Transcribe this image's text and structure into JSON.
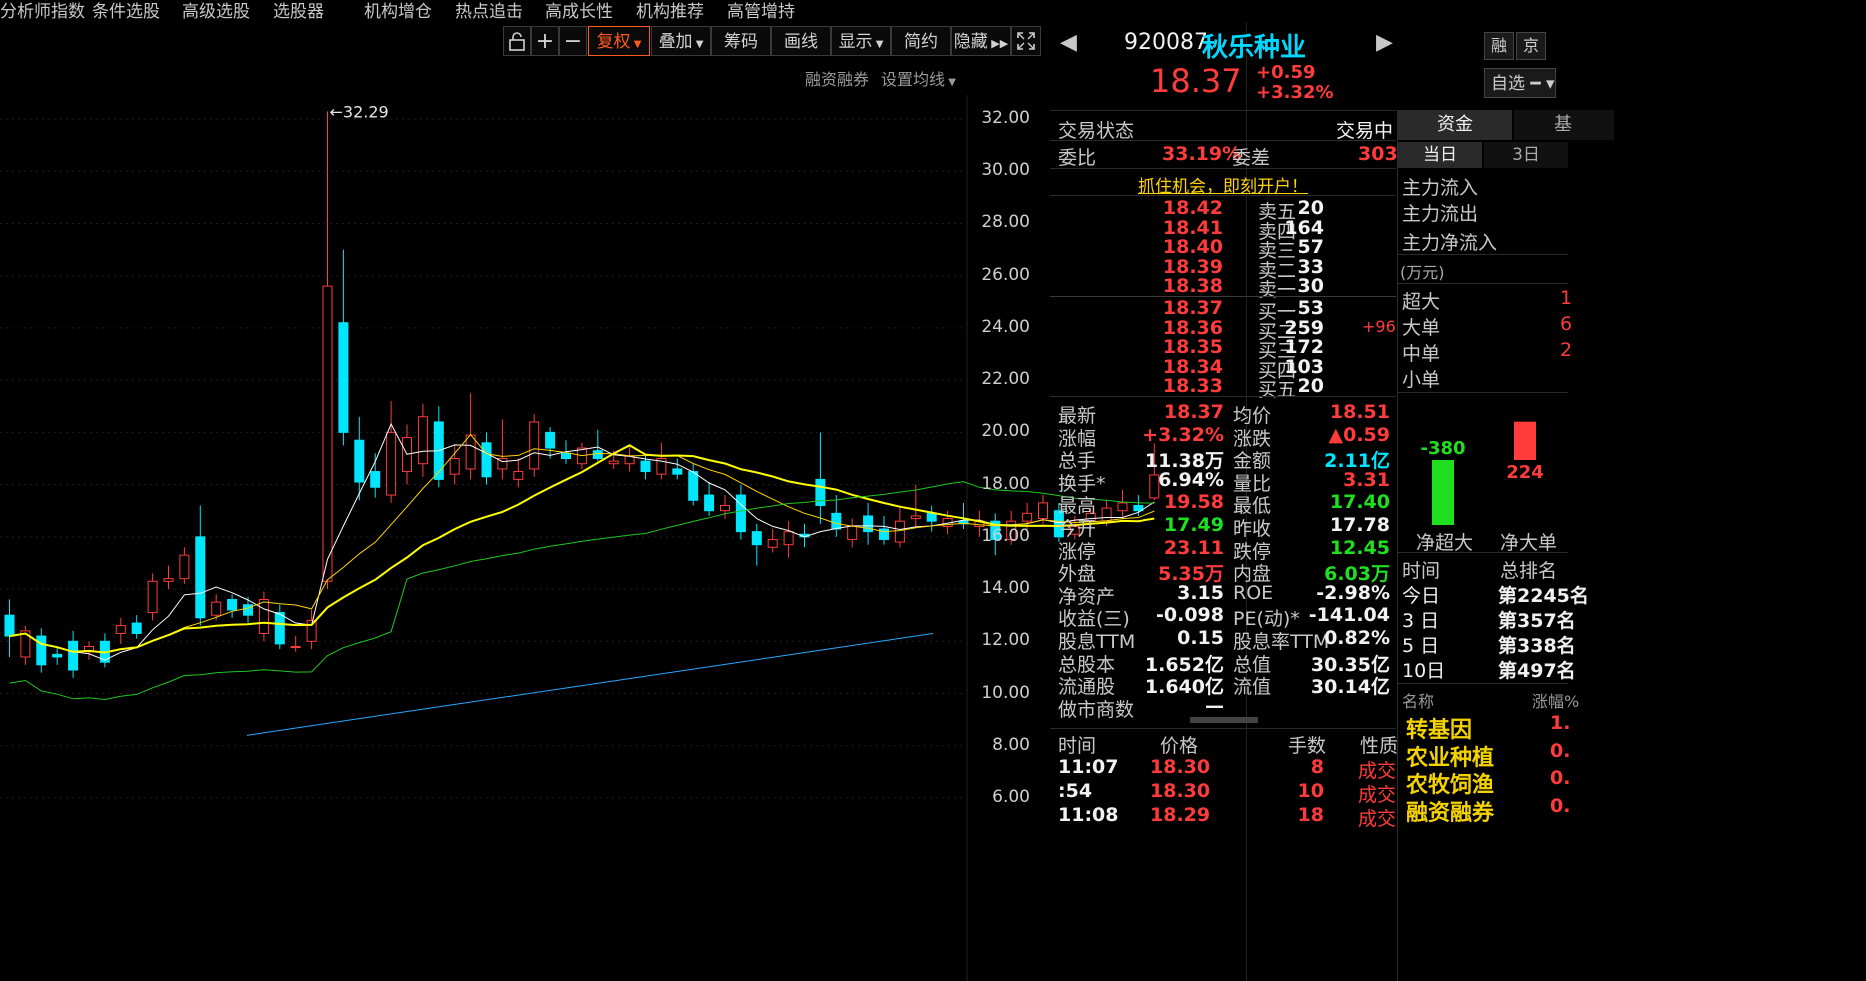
{
  "topnav": [
    "分析师指数",
    "条件选股",
    "高级选股",
    "选股器",
    "机构增仓",
    "热点追击",
    "高成长性",
    "机构推荐",
    "高管增持"
  ],
  "toolbar": {
    "lock_icon": "lock-icon",
    "plus": "+",
    "minus": "−",
    "fuquan": "复权",
    "diejia": "叠加",
    "chouma": "筹码",
    "huaxian": "画线",
    "xianshi": "显示",
    "jianyue": "简约",
    "yincang": "隐藏",
    "fullscreen_icon": "fullscreen-icon"
  },
  "subtoolbar": {
    "rzrq": "融资融券",
    "set_ma": "设置均线"
  },
  "chart": {
    "high_label": "←32.29",
    "yticks": [
      "32.00",
      "30.00",
      "28.00",
      "26.00",
      "24.00",
      "22.00",
      "20.00",
      "18.00",
      "16.00",
      "14.00",
      "12.00",
      "10.00",
      "8.00",
      "6.00"
    ],
    "colors": {
      "up": "#ff3b3b",
      "down": "#00e6ff",
      "ma5": "#ffffff",
      "ma10": "#ffd400",
      "ma20": "#ffff00",
      "ma60": "#1fc81f",
      "ma250": "#2aa9ff"
    }
  },
  "chart_data": {
    "type": "candlestick",
    "ylim": [
      6,
      33
    ],
    "high_marker": 32.29,
    "candles": [
      {
        "o": 13.0,
        "c": 12.2,
        "h": 13.6,
        "l": 11.4
      },
      {
        "o": 11.4,
        "c": 12.4,
        "h": 12.6,
        "l": 11.1
      },
      {
        "o": 12.2,
        "c": 11.1,
        "h": 12.5,
        "l": 10.8
      },
      {
        "o": 11.5,
        "c": 11.4,
        "h": 11.8,
        "l": 11.1
      },
      {
        "o": 12.0,
        "c": 10.9,
        "h": 12.4,
        "l": 10.6
      },
      {
        "o": 11.6,
        "c": 11.8,
        "h": 12.0,
        "l": 11.3
      },
      {
        "o": 12.0,
        "c": 11.2,
        "h": 12.3,
        "l": 11.0
      },
      {
        "o": 12.3,
        "c": 12.6,
        "h": 12.9,
        "l": 11.9
      },
      {
        "o": 12.7,
        "c": 12.3,
        "h": 13.0,
        "l": 12.1
      },
      {
        "o": 13.1,
        "c": 14.3,
        "h": 14.6,
        "l": 12.8
      },
      {
        "o": 14.3,
        "c": 14.4,
        "h": 14.9,
        "l": 14.0
      },
      {
        "o": 14.4,
        "c": 15.3,
        "h": 15.6,
        "l": 14.2
      },
      {
        "o": 16.0,
        "c": 12.9,
        "h": 17.2,
        "l": 12.6
      },
      {
        "o": 13.0,
        "c": 13.5,
        "h": 13.8,
        "l": 12.8
      },
      {
        "o": 13.6,
        "c": 13.2,
        "h": 13.8,
        "l": 12.9
      },
      {
        "o": 13.4,
        "c": 13.0,
        "h": 13.7,
        "l": 12.7
      },
      {
        "o": 12.3,
        "c": 13.6,
        "h": 13.9,
        "l": 12.0
      },
      {
        "o": 13.1,
        "c": 11.9,
        "h": 13.4,
        "l": 11.7
      },
      {
        "o": 11.8,
        "c": 11.8,
        "h": 12.2,
        "l": 11.6
      },
      {
        "o": 12.0,
        "c": 12.8,
        "h": 13.2,
        "l": 11.7
      },
      {
        "o": 14.3,
        "c": 25.6,
        "h": 32.29,
        "l": 14.0
      },
      {
        "o": 24.2,
        "c": 20.0,
        "h": 27.0,
        "l": 19.5
      },
      {
        "o": 19.7,
        "c": 18.1,
        "h": 20.6,
        "l": 17.4
      },
      {
        "o": 18.5,
        "c": 17.9,
        "h": 19.2,
        "l": 17.5
      },
      {
        "o": 17.6,
        "c": 20.0,
        "h": 21.2,
        "l": 17.3
      },
      {
        "o": 18.5,
        "c": 19.8,
        "h": 20.3,
        "l": 18.0
      },
      {
        "o": 18.8,
        "c": 20.6,
        "h": 21.1,
        "l": 18.3
      },
      {
        "o": 20.4,
        "c": 18.2,
        "h": 21.0,
        "l": 17.9
      },
      {
        "o": 18.4,
        "c": 19.0,
        "h": 19.5,
        "l": 18.0
      },
      {
        "o": 18.6,
        "c": 19.9,
        "h": 21.5,
        "l": 18.2
      },
      {
        "o": 19.6,
        "c": 18.3,
        "h": 20.0,
        "l": 18.0
      },
      {
        "o": 18.6,
        "c": 19.0,
        "h": 20.5,
        "l": 18.2
      },
      {
        "o": 18.2,
        "c": 18.5,
        "h": 19.0,
        "l": 17.9
      },
      {
        "o": 18.6,
        "c": 20.4,
        "h": 20.7,
        "l": 18.3
      },
      {
        "o": 20.0,
        "c": 19.4,
        "h": 20.2,
        "l": 19.0
      },
      {
        "o": 19.2,
        "c": 19.0,
        "h": 19.7,
        "l": 18.8
      },
      {
        "o": 18.8,
        "c": 19.4,
        "h": 19.6,
        "l": 18.6
      },
      {
        "o": 19.3,
        "c": 19.0,
        "h": 20.1,
        "l": 18.9
      },
      {
        "o": 18.8,
        "c": 18.9,
        "h": 19.3,
        "l": 18.6
      },
      {
        "o": 18.8,
        "c": 19.1,
        "h": 19.5,
        "l": 18.5
      },
      {
        "o": 18.9,
        "c": 18.5,
        "h": 19.1,
        "l": 18.2
      },
      {
        "o": 18.4,
        "c": 19.0,
        "h": 19.6,
        "l": 18.2
      },
      {
        "o": 18.6,
        "c": 18.4,
        "h": 19.0,
        "l": 18.2
      },
      {
        "o": 18.5,
        "c": 17.4,
        "h": 18.8,
        "l": 17.2
      },
      {
        "o": 17.6,
        "c": 17.0,
        "h": 18.1,
        "l": 16.8
      },
      {
        "o": 17.0,
        "c": 17.2,
        "h": 17.6,
        "l": 16.7
      },
      {
        "o": 17.6,
        "c": 16.2,
        "h": 18.0,
        "l": 15.9
      },
      {
        "o": 16.2,
        "c": 15.7,
        "h": 16.5,
        "l": 14.9
      },
      {
        "o": 15.6,
        "c": 15.9,
        "h": 16.3,
        "l": 15.4
      },
      {
        "o": 15.7,
        "c": 16.2,
        "h": 16.6,
        "l": 15.2
      },
      {
        "o": 16.1,
        "c": 16.0,
        "h": 16.5,
        "l": 15.6
      },
      {
        "o": 18.2,
        "c": 17.2,
        "h": 20.0,
        "l": 16.5
      },
      {
        "o": 16.9,
        "c": 16.3,
        "h": 17.6,
        "l": 16.0
      },
      {
        "o": 15.9,
        "c": 16.4,
        "h": 16.7,
        "l": 15.6
      },
      {
        "o": 16.8,
        "c": 16.2,
        "h": 17.3,
        "l": 15.7
      },
      {
        "o": 16.3,
        "c": 15.9,
        "h": 16.8,
        "l": 15.7
      },
      {
        "o": 15.8,
        "c": 16.6,
        "h": 17.2,
        "l": 15.6
      },
      {
        "o": 16.7,
        "c": 16.8,
        "h": 18.0,
        "l": 16.4
      },
      {
        "o": 16.9,
        "c": 16.6,
        "h": 17.2,
        "l": 16.2
      },
      {
        "o": 16.4,
        "c": 16.7,
        "h": 17.0,
        "l": 16.1
      },
      {
        "o": 16.6,
        "c": 16.5,
        "h": 17.3,
        "l": 16.3
      },
      {
        "o": 16.4,
        "c": 16.6,
        "h": 17.0,
        "l": 16.0
      },
      {
        "o": 16.6,
        "c": 15.9,
        "h": 16.9,
        "l": 15.3
      },
      {
        "o": 15.9,
        "c": 16.6,
        "h": 17.0,
        "l": 15.7
      },
      {
        "o": 16.6,
        "c": 16.9,
        "h": 17.3,
        "l": 16.3
      },
      {
        "o": 16.7,
        "c": 17.3,
        "h": 17.6,
        "l": 16.5
      },
      {
        "o": 17.0,
        "c": 16.0,
        "h": 17.3,
        "l": 15.8
      },
      {
        "o": 16.1,
        "c": 16.4,
        "h": 16.8,
        "l": 15.9
      },
      {
        "o": 16.6,
        "c": 16.9,
        "h": 17.1,
        "l": 16.3
      },
      {
        "o": 16.6,
        "c": 17.1,
        "h": 17.4,
        "l": 16.4
      },
      {
        "o": 17.0,
        "c": 17.3,
        "h": 17.8,
        "l": 16.7
      },
      {
        "o": 17.2,
        "c": 17.0,
        "h": 17.6,
        "l": 16.8
      },
      {
        "o": 17.49,
        "c": 18.37,
        "h": 19.58,
        "l": 17.4
      }
    ]
  },
  "stock": {
    "code": "920087",
    "name": "秋乐种业",
    "price": "18.37",
    "change": "+0.59",
    "pct": "+3.32%",
    "btn_rong": "融",
    "btn_jing": "京",
    "zixuan": "自选"
  },
  "status": {
    "label": "交易状态",
    "value": "交易中",
    "weibi_label": "委比",
    "weibi": "33.19%",
    "weicha_label": "委差",
    "weicha": "303",
    "promo": "抓住机会，即刻开户！"
  },
  "orderbook": {
    "asks": [
      {
        "label": "卖五",
        "price": "18.42",
        "vol": "20"
      },
      {
        "label": "卖四",
        "price": "18.41",
        "vol": "164"
      },
      {
        "label": "卖三",
        "price": "18.40",
        "vol": "57"
      },
      {
        "label": "卖二",
        "price": "18.39",
        "vol": "33"
      },
      {
        "label": "卖一",
        "price": "18.38",
        "vol": "30"
      }
    ],
    "bids": [
      {
        "label": "买一",
        "price": "18.37",
        "vol": "53"
      },
      {
        "label": "买二",
        "price": "18.36",
        "vol": "259"
      },
      {
        "label": "买三",
        "price": "18.35",
        "vol": "172"
      },
      {
        "label": "买四",
        "price": "18.34",
        "vol": "103"
      },
      {
        "label": "买五",
        "price": "18.33",
        "vol": "20"
      }
    ],
    "bid2_change": "+96"
  },
  "stats": {
    "left": [
      {
        "label": "最新",
        "value": "18.37",
        "color": "red"
      },
      {
        "label": "涨幅",
        "value": "+3.32%",
        "color": "red"
      },
      {
        "label": "总手",
        "value": "11.38万",
        "color": "white"
      },
      {
        "label": "换手*",
        "value": "6.94%",
        "color": "white"
      },
      {
        "label": "最高",
        "value": "19.58",
        "color": "red"
      },
      {
        "label": "今开",
        "value": "17.49",
        "color": "green"
      },
      {
        "label": "涨停",
        "value": "23.11",
        "color": "red"
      },
      {
        "label": "外盘",
        "value": "5.35万",
        "color": "red"
      },
      {
        "label": "净资产",
        "value": "3.15",
        "color": "white"
      },
      {
        "label": "收益(三)",
        "value": "-0.098",
        "color": "white"
      },
      {
        "label": "股息TTM",
        "value": "0.15",
        "color": "white"
      },
      {
        "label": "总股本",
        "value": "1.652亿",
        "color": "white"
      },
      {
        "label": "流通股",
        "value": "1.640亿",
        "color": "white"
      },
      {
        "label": "做市商数",
        "value": "—",
        "color": "white"
      }
    ],
    "right": [
      {
        "label": "均价",
        "value": "18.51",
        "color": "red"
      },
      {
        "label": "涨跌",
        "value": "▲0.59",
        "color": "red"
      },
      {
        "label": "金额",
        "value": "2.11亿",
        "color": "cyan"
      },
      {
        "label": "量比",
        "value": "3.31",
        "color": "red"
      },
      {
        "label": "最低",
        "value": "17.40",
        "color": "green"
      },
      {
        "label": "昨收",
        "value": "17.78",
        "color": "white"
      },
      {
        "label": "跌停",
        "value": "12.45",
        "color": "green"
      },
      {
        "label": "内盘",
        "value": "6.03万",
        "color": "green"
      },
      {
        "label": "ROE",
        "value": "-2.98%",
        "color": "white"
      },
      {
        "label": "PE(动)*",
        "value": "-141.04",
        "color": "white"
      },
      {
        "label": "股息率TTM",
        "value": "0.82%",
        "color": "white"
      },
      {
        "label": "总值",
        "value": "30.35亿",
        "color": "white"
      },
      {
        "label": "流值",
        "value": "30.14亿",
        "color": "white"
      }
    ]
  },
  "ticks": {
    "headers": [
      "时间",
      "价格",
      "手数",
      "性质"
    ],
    "rows": [
      {
        "time": "11:07",
        "price": "18.30",
        "vol": "8",
        "kind": "成交"
      },
      {
        "time": ":54",
        "price": "18.30",
        "vol": "10",
        "kind": "成交"
      },
      {
        "time": "11:08",
        "price": "18.29",
        "vol": "18",
        "kind": "成交"
      }
    ]
  },
  "fundflow": {
    "tabs": [
      "资金",
      "基"
    ],
    "subtabs": [
      "当日",
      "3日"
    ],
    "rows": [
      "主力流入",
      "主力流出",
      "主力净流入"
    ],
    "unit": "(万元)",
    "sizes": [
      "超大",
      "大单",
      "中单",
      "小单"
    ],
    "size_vals": [
      "1",
      "6",
      "2",
      ""
    ],
    "bars": [
      {
        "label": "净超大",
        "value": -380
      },
      {
        "label": "净大单",
        "value": 224
      }
    ],
    "rank_header": [
      "时间",
      "总排名"
    ],
    "ranks": [
      {
        "period": "今日",
        "rank": "第2245名"
      },
      {
        "period": "3 日",
        "rank": "第357名"
      },
      {
        "period": "5 日",
        "rank": "第338名"
      },
      {
        "period": "10日",
        "rank": "第497名"
      }
    ],
    "concept_header": [
      "名称",
      "涨幅%"
    ],
    "concepts": [
      {
        "name": "转基因",
        "val": "1."
      },
      {
        "name": "农业种植",
        "val": "0."
      },
      {
        "name": "农牧饲渔",
        "val": "0."
      },
      {
        "name": "融资融券",
        "val": "0."
      }
    ]
  }
}
